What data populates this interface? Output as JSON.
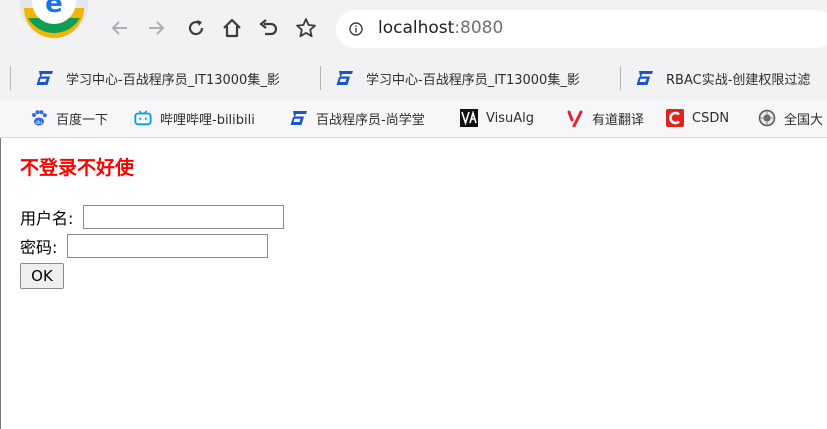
{
  "browser": {
    "address": {
      "host": "localhost",
      "port": ":8080"
    },
    "tabs": [
      {
        "label": "学习中心-百战程序员_IT13000集_影"
      },
      {
        "label": "学习中心-百战程序员_IT13000集_影"
      },
      {
        "label": "RBAC实战-创建权限过滤"
      }
    ],
    "bookmarks": [
      {
        "label": "百度一下",
        "icon": "baidu-paw-icon"
      },
      {
        "label": "哔哩哔哩-bilibili",
        "icon": "bilibili-tv-icon"
      },
      {
        "label": "百战程序员-尚学堂",
        "icon": "baizhan-logo-icon"
      },
      {
        "label": "VisuAlg",
        "icon": "visualgo-logo-icon"
      },
      {
        "label": "有道翻译",
        "icon": "youdao-logo-icon"
      },
      {
        "label": "CSDN",
        "icon": "csdn-logo-icon"
      },
      {
        "label": "全国大",
        "icon": "globe-emblem-icon"
      }
    ]
  },
  "page": {
    "title": "不登录不好使",
    "username_label": "用户名:",
    "password_label": "密码:",
    "username_value": "",
    "password_value": "",
    "submit_label": "OK"
  },
  "colors": {
    "title_red": "#ff0000",
    "chrome_bg": "#f2f2f5",
    "baizhan_blue": "#1a56c9",
    "youdao_red": "#e8202f",
    "csdn_red": "#e2231a"
  }
}
